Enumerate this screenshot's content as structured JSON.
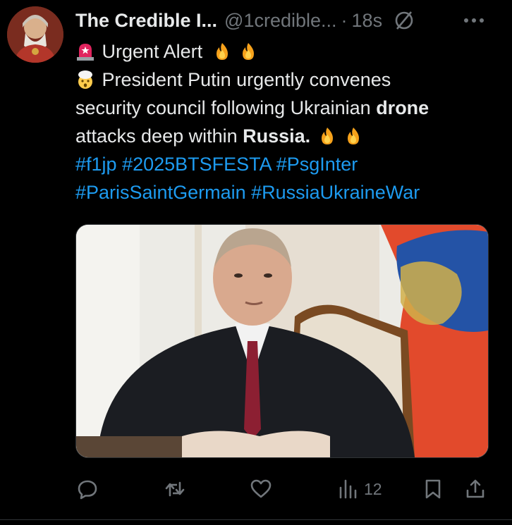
{
  "post": {
    "author_name": "The Credible I...",
    "handle": "@1credible...",
    "separator": "·",
    "time": "18s",
    "more_label": "•••",
    "line1_text": "Urgent Alert",
    "line2_text": "President Putin urgently convenes",
    "line3_text": "security council following Ukrainian ",
    "line3_bold": "drone",
    "line4_text": "attacks deep within ",
    "line4_bold": "Russia.",
    "hashtags_line1": [
      "#f1jp",
      "#2025BTSFESTA",
      "#PsgInter"
    ],
    "hashtags_line2": [
      "#ParisSaintGermain",
      "#RussiaUkraineWar"
    ]
  },
  "actions": {
    "views_count": "12"
  },
  "icons": [
    "rotating-light-icon",
    "fire-icon",
    "exploding-head-icon",
    "grok-icon",
    "more-icon",
    "reply-icon",
    "repost-icon",
    "like-icon",
    "views-icon",
    "bookmark-icon",
    "share-icon"
  ],
  "colors": {
    "background": "#000000",
    "text": "#e7e9ea",
    "muted": "#71767b",
    "link": "#1d9bf0"
  }
}
